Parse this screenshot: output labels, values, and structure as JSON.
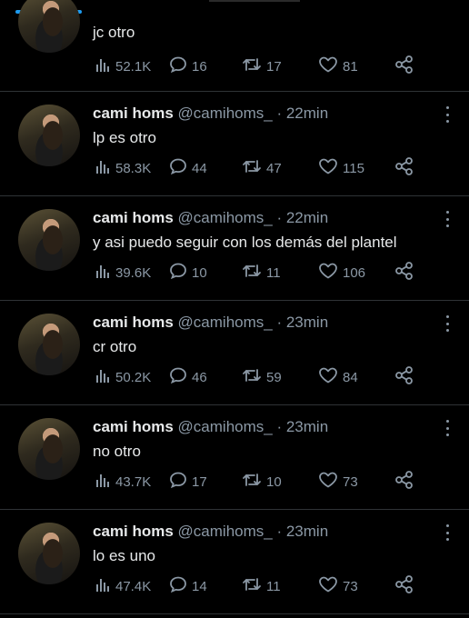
{
  "tweets": [
    {
      "name": "",
      "handle": "",
      "time": "",
      "text": "jc otro",
      "views": "52.1K",
      "replies": "16",
      "retweets": "17",
      "likes": "81"
    },
    {
      "name": "cami homs",
      "handle": "@camihoms_",
      "time": " · 22min",
      "text": "lp es otro",
      "views": "58.3K",
      "replies": "44",
      "retweets": "47",
      "likes": "115"
    },
    {
      "name": "cami homs",
      "handle": "@camihoms_",
      "time": " · 22min",
      "text": "y asi puedo seguir con los demás del plantel",
      "views": "39.6K",
      "replies": "10",
      "retweets": "11",
      "likes": "106"
    },
    {
      "name": "cami homs",
      "handle": "@camihoms_",
      "time": " · 23min",
      "text": "cr otro",
      "views": "50.2K",
      "replies": "46",
      "retweets": "59",
      "likes": "84"
    },
    {
      "name": "cami homs",
      "handle": "@camihoms_",
      "time": " · 23min",
      "text": "no otro",
      "views": "43.7K",
      "replies": "17",
      "retweets": "10",
      "likes": "73"
    },
    {
      "name": "cami homs",
      "handle": "@camihoms_",
      "time": " · 23min",
      "text": "lo es uno",
      "views": "47.4K",
      "replies": "14",
      "retweets": "11",
      "likes": "73"
    }
  ],
  "icons": {
    "views": "views-icon",
    "reply": "reply-icon",
    "retweet": "retweet-icon",
    "like": "like-icon",
    "share": "share-icon",
    "more": "more-icon"
  },
  "colors": {
    "background": "#000000",
    "text": "#e7e9ea",
    "muted": "#8b98a5",
    "divider": "#2f3336",
    "accent": "#1d9bf0"
  }
}
